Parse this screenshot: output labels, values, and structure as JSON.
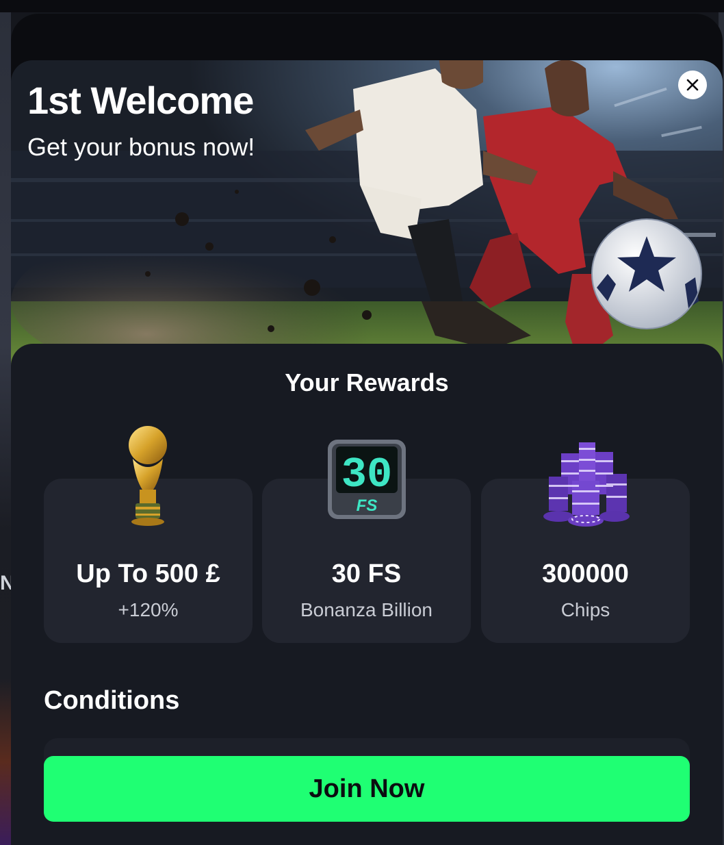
{
  "background": {
    "partial_letter": "N"
  },
  "modal": {
    "title": "1st Welcome",
    "subtitle": "Get your bonus now!",
    "close_icon": "close-icon",
    "rewards_heading": "Your Rewards",
    "rewards": [
      {
        "icon": "trophy-icon",
        "value": "Up To 500 £",
        "detail": "+120%"
      },
      {
        "icon": "free-spins-counter-icon",
        "value": "30 FS",
        "detail": "Bonanza Billion",
        "icon_text": "30",
        "icon_badge": "FS"
      },
      {
        "icon": "chips-stack-icon",
        "value": "300000",
        "detail": "Chips"
      }
    ],
    "conditions_heading": "Conditions",
    "cta_label": "Join Now"
  },
  "colors": {
    "modal_bg": "#0b0c10",
    "sheet_bg": "#171a22",
    "card_bg": "#22252f",
    "accent_green": "#1fff73",
    "counter_digits": "#3ee6c4"
  }
}
